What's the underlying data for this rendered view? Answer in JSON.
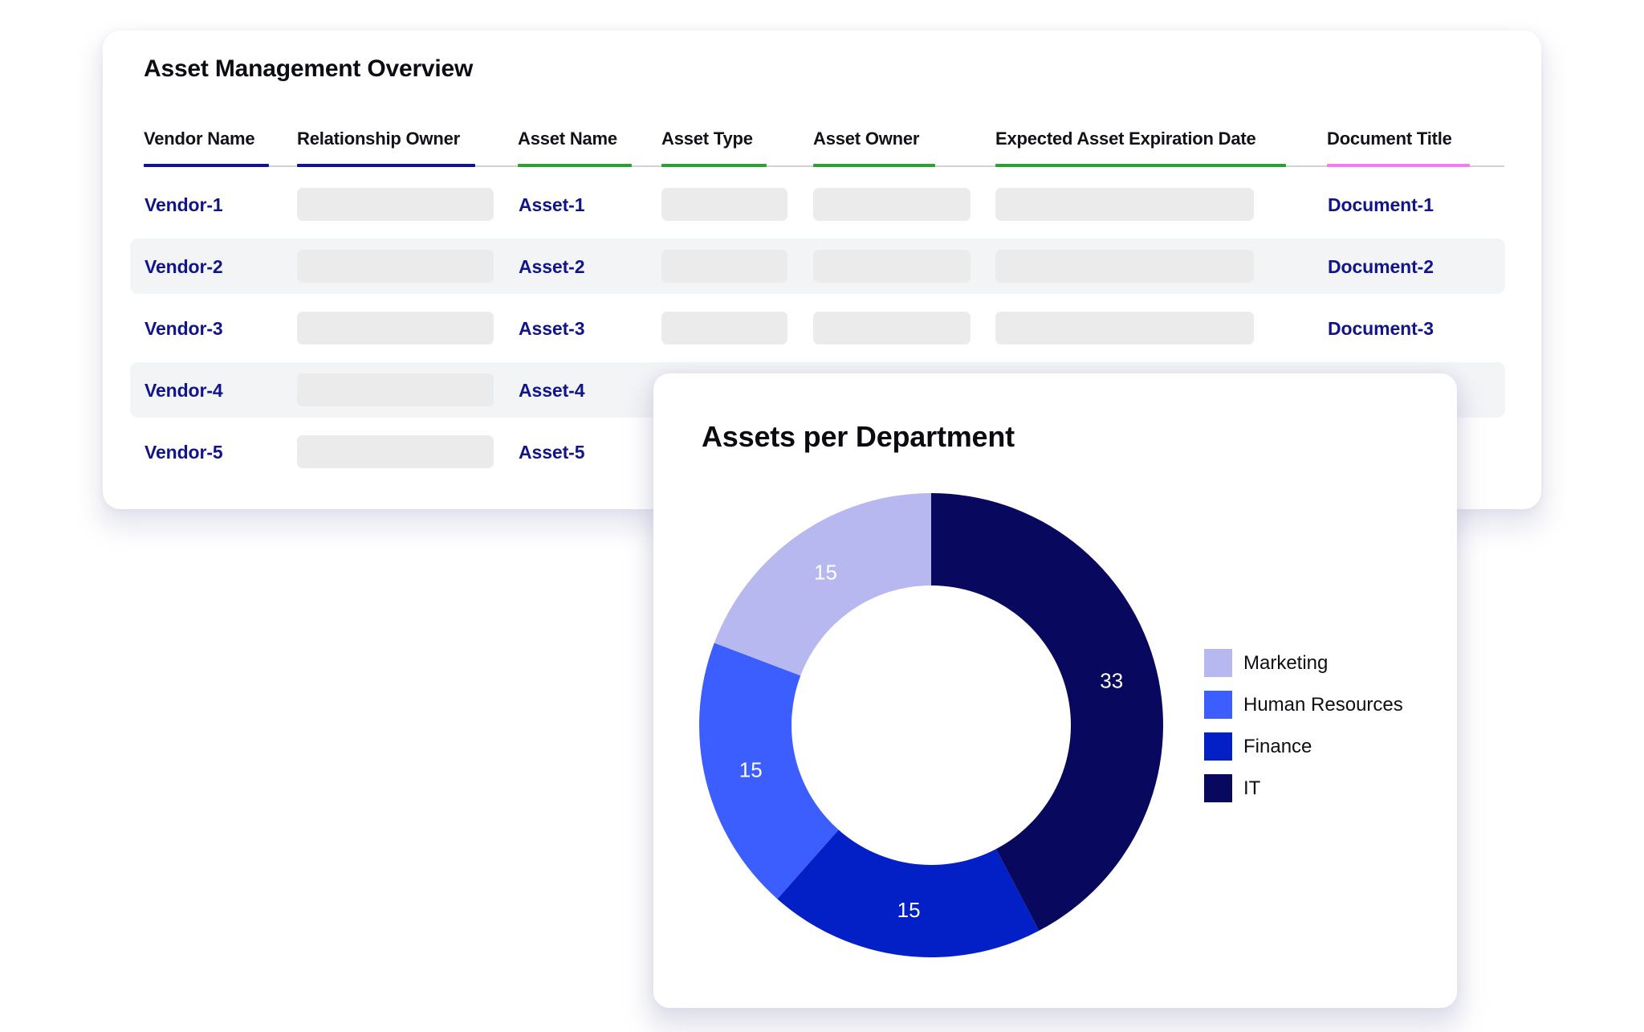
{
  "table_card": {
    "title": "Asset Management Overview",
    "columns": [
      {
        "label": "Vendor Name",
        "accent": "#14148a"
      },
      {
        "label": "Relationship Owner",
        "accent": "#14148a"
      },
      {
        "label": "Asset Name",
        "accent": "#2f9e36"
      },
      {
        "label": "Asset Type",
        "accent": "#2f9e36"
      },
      {
        "label": "Asset Owner",
        "accent": "#2f9e36"
      },
      {
        "label": "Expected Asset Expiration Date",
        "accent": "#2f9e36"
      },
      {
        "label": "Document Title",
        "accent": "#f07cf0"
      }
    ],
    "rows": [
      {
        "vendor": "Vendor-1",
        "asset": "Asset-1",
        "document": "Document-1"
      },
      {
        "vendor": "Vendor-2",
        "asset": "Asset-2",
        "document": "Document-2"
      },
      {
        "vendor": "Vendor-3",
        "asset": "Asset-3",
        "document": "Document-3"
      },
      {
        "vendor": "Vendor-4",
        "asset": "Asset-4",
        "document": ""
      },
      {
        "vendor": "Vendor-5",
        "asset": "Asset-5",
        "document": ""
      }
    ]
  },
  "chart_data": {
    "type": "pie",
    "variant": "donut",
    "title": "Assets per Department",
    "categories": [
      "Marketing",
      "Human Resources",
      "Finance",
      "IT"
    ],
    "values": [
      15,
      15,
      15,
      33
    ],
    "colors": [
      "#b8b8f0",
      "#3d5eff",
      "#0220c6",
      "#08085e"
    ],
    "data_labels": [
      "15",
      "15",
      "15",
      "33"
    ],
    "start_angle": "12 o'clock, IT first, clockwise",
    "legend_position": "right"
  }
}
